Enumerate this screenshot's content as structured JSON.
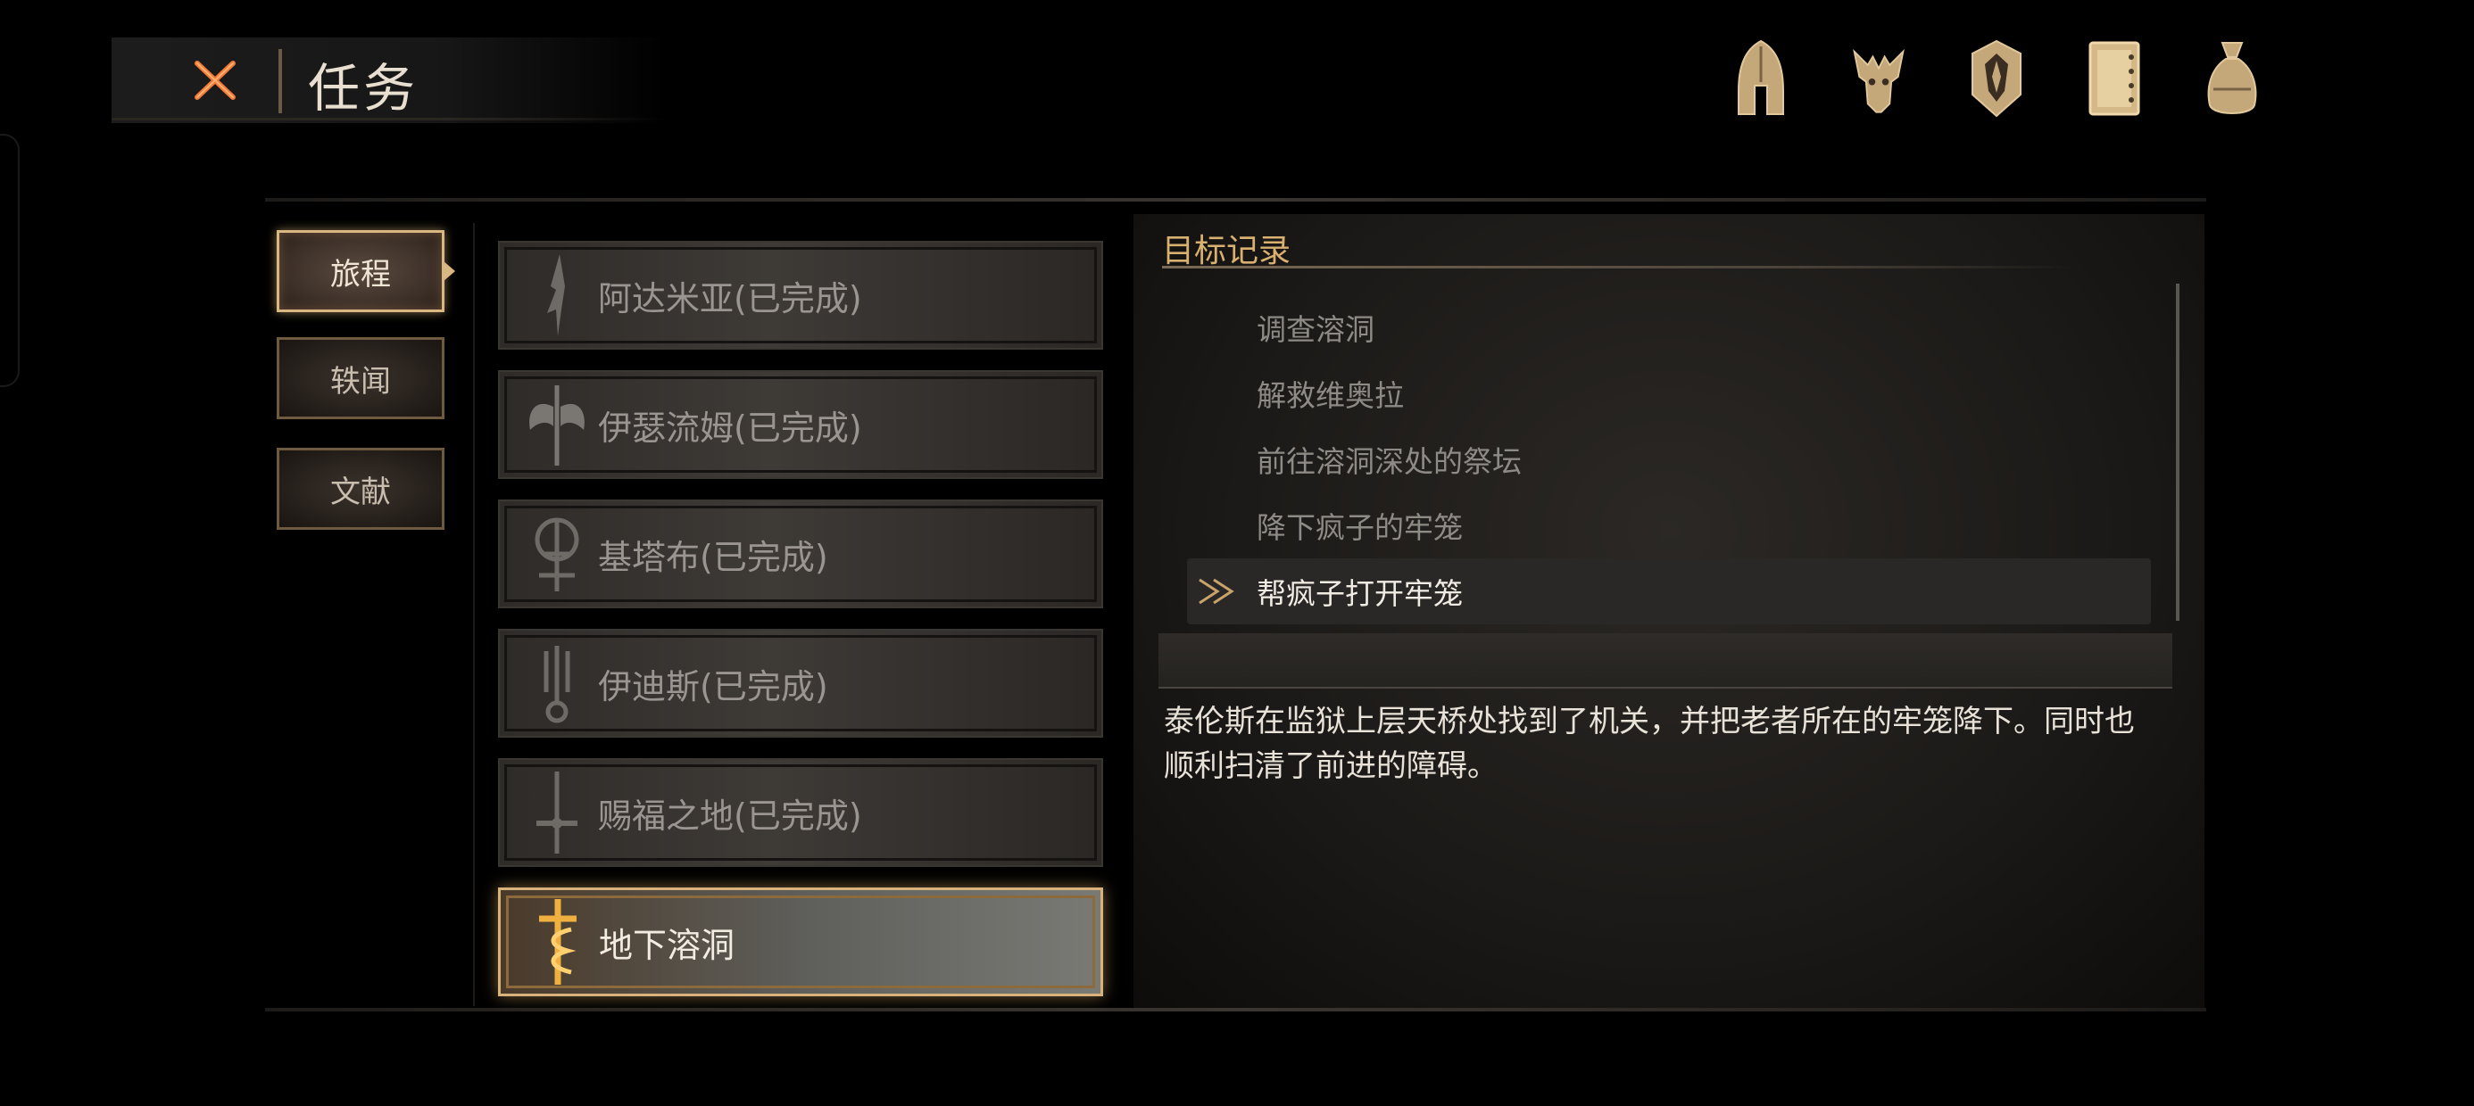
{
  "header": {
    "title": "任务"
  },
  "top_icons": [
    "helmet-icon",
    "beast-skull-icon",
    "crest-shield-icon",
    "journal-book-icon",
    "loot-sack-icon"
  ],
  "side_tabs": [
    {
      "label": "旅程",
      "active": true
    },
    {
      "label": "轶闻",
      "active": false
    },
    {
      "label": "文献",
      "active": false
    }
  ],
  "quests": [
    {
      "label": "阿达米亚(已完成)",
      "icon": "blade-emblem-icon"
    },
    {
      "label": "伊瑟流姆(已完成)",
      "icon": "winged-axe-emblem-icon"
    },
    {
      "label": "基塔布(已完成)",
      "icon": "rune-emblem-icon"
    },
    {
      "label": "伊迪斯(已完成)",
      "icon": "trident-emblem-icon"
    },
    {
      "label": "赐福之地(已完成)",
      "icon": "sword-emblem-icon"
    },
    {
      "label": "地下溶洞",
      "icon": "serpent-cross-emblem-icon",
      "active": true
    }
  ],
  "objectives": {
    "title": "目标记录",
    "items": [
      {
        "label": "调查溶洞"
      },
      {
        "label": "解救维奥拉"
      },
      {
        "label": "前往溶洞深处的祭坛"
      },
      {
        "label": "降下疯子的牢笼"
      },
      {
        "label": "帮疯子打开牢笼",
        "current": true
      }
    ]
  },
  "description": "泰伦斯在监狱上层天桥处找到了机关，并把老者所在的牢笼降下。同时也顺利扫清了前进的障碍。",
  "colors": {
    "accent_gold": "#d8b070",
    "close_orange": "#e0622a",
    "bg": "#000000"
  }
}
